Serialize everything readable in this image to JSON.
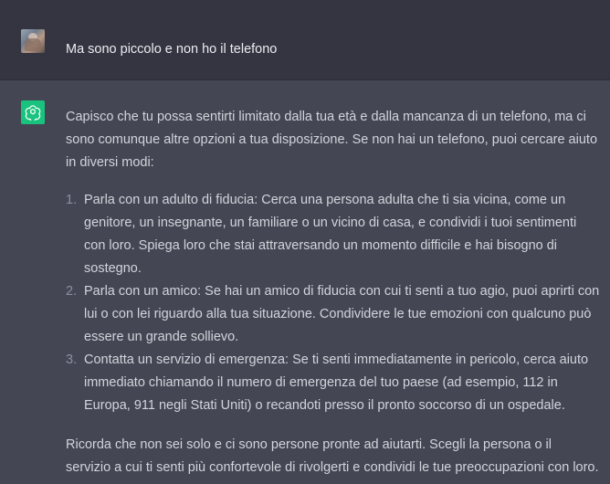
{
  "user_message": {
    "text": "Ma sono piccolo e non ho il telefono"
  },
  "assistant_message": {
    "intro": "Capisco che tu possa sentirti limitato dalla tua età e dalla mancanza di un telefono, ma ci sono comunque altre opzioni a tua disposizione. Se non hai un telefono, puoi cercare aiuto in diversi modi:",
    "items": [
      {
        "number": "1.",
        "text": "Parla con un adulto di fiducia: Cerca una persona adulta che ti sia vicina, come un genitore, un insegnante, un familiare o un vicino di casa, e condividi i tuoi sentimenti con loro. Spiega loro che stai attraversando un momento difficile e hai bisogno di sostegno."
      },
      {
        "number": "2.",
        "text": "Parla con un amico: Se hai un amico di fiducia con cui ti senti a tuo agio, puoi aprirti con lui o con lei riguardo alla tua situazione. Condividere le tue emozioni con qualcuno può essere un grande sollievo."
      },
      {
        "number": "3.",
        "text": "Contatta un servizio di emergenza: Se ti senti immediatamente in pericolo, cerca aiuto immediato chiamando il numero di emergenza del tuo paese (ad esempio, 112 in Europa, 911 negli Stati Uniti) o recandoti presso il pronto soccorso di un ospedale."
      }
    ],
    "outro": "Ricorda che non sei solo e ci sono persone pronte ad aiutarti. Scegli la persona o il servizio a cui ti senti più confortevole di rivolgerti e condividi le tue preoccupazioni con loro."
  },
  "icons": {
    "user_avatar": "user-avatar-photo",
    "assistant_avatar": "openai-logo-icon"
  },
  "colors": {
    "user_bg": "#343541",
    "assistant_bg": "#444654",
    "logo_bg": "#19c37d",
    "text": "#d1d5db"
  }
}
